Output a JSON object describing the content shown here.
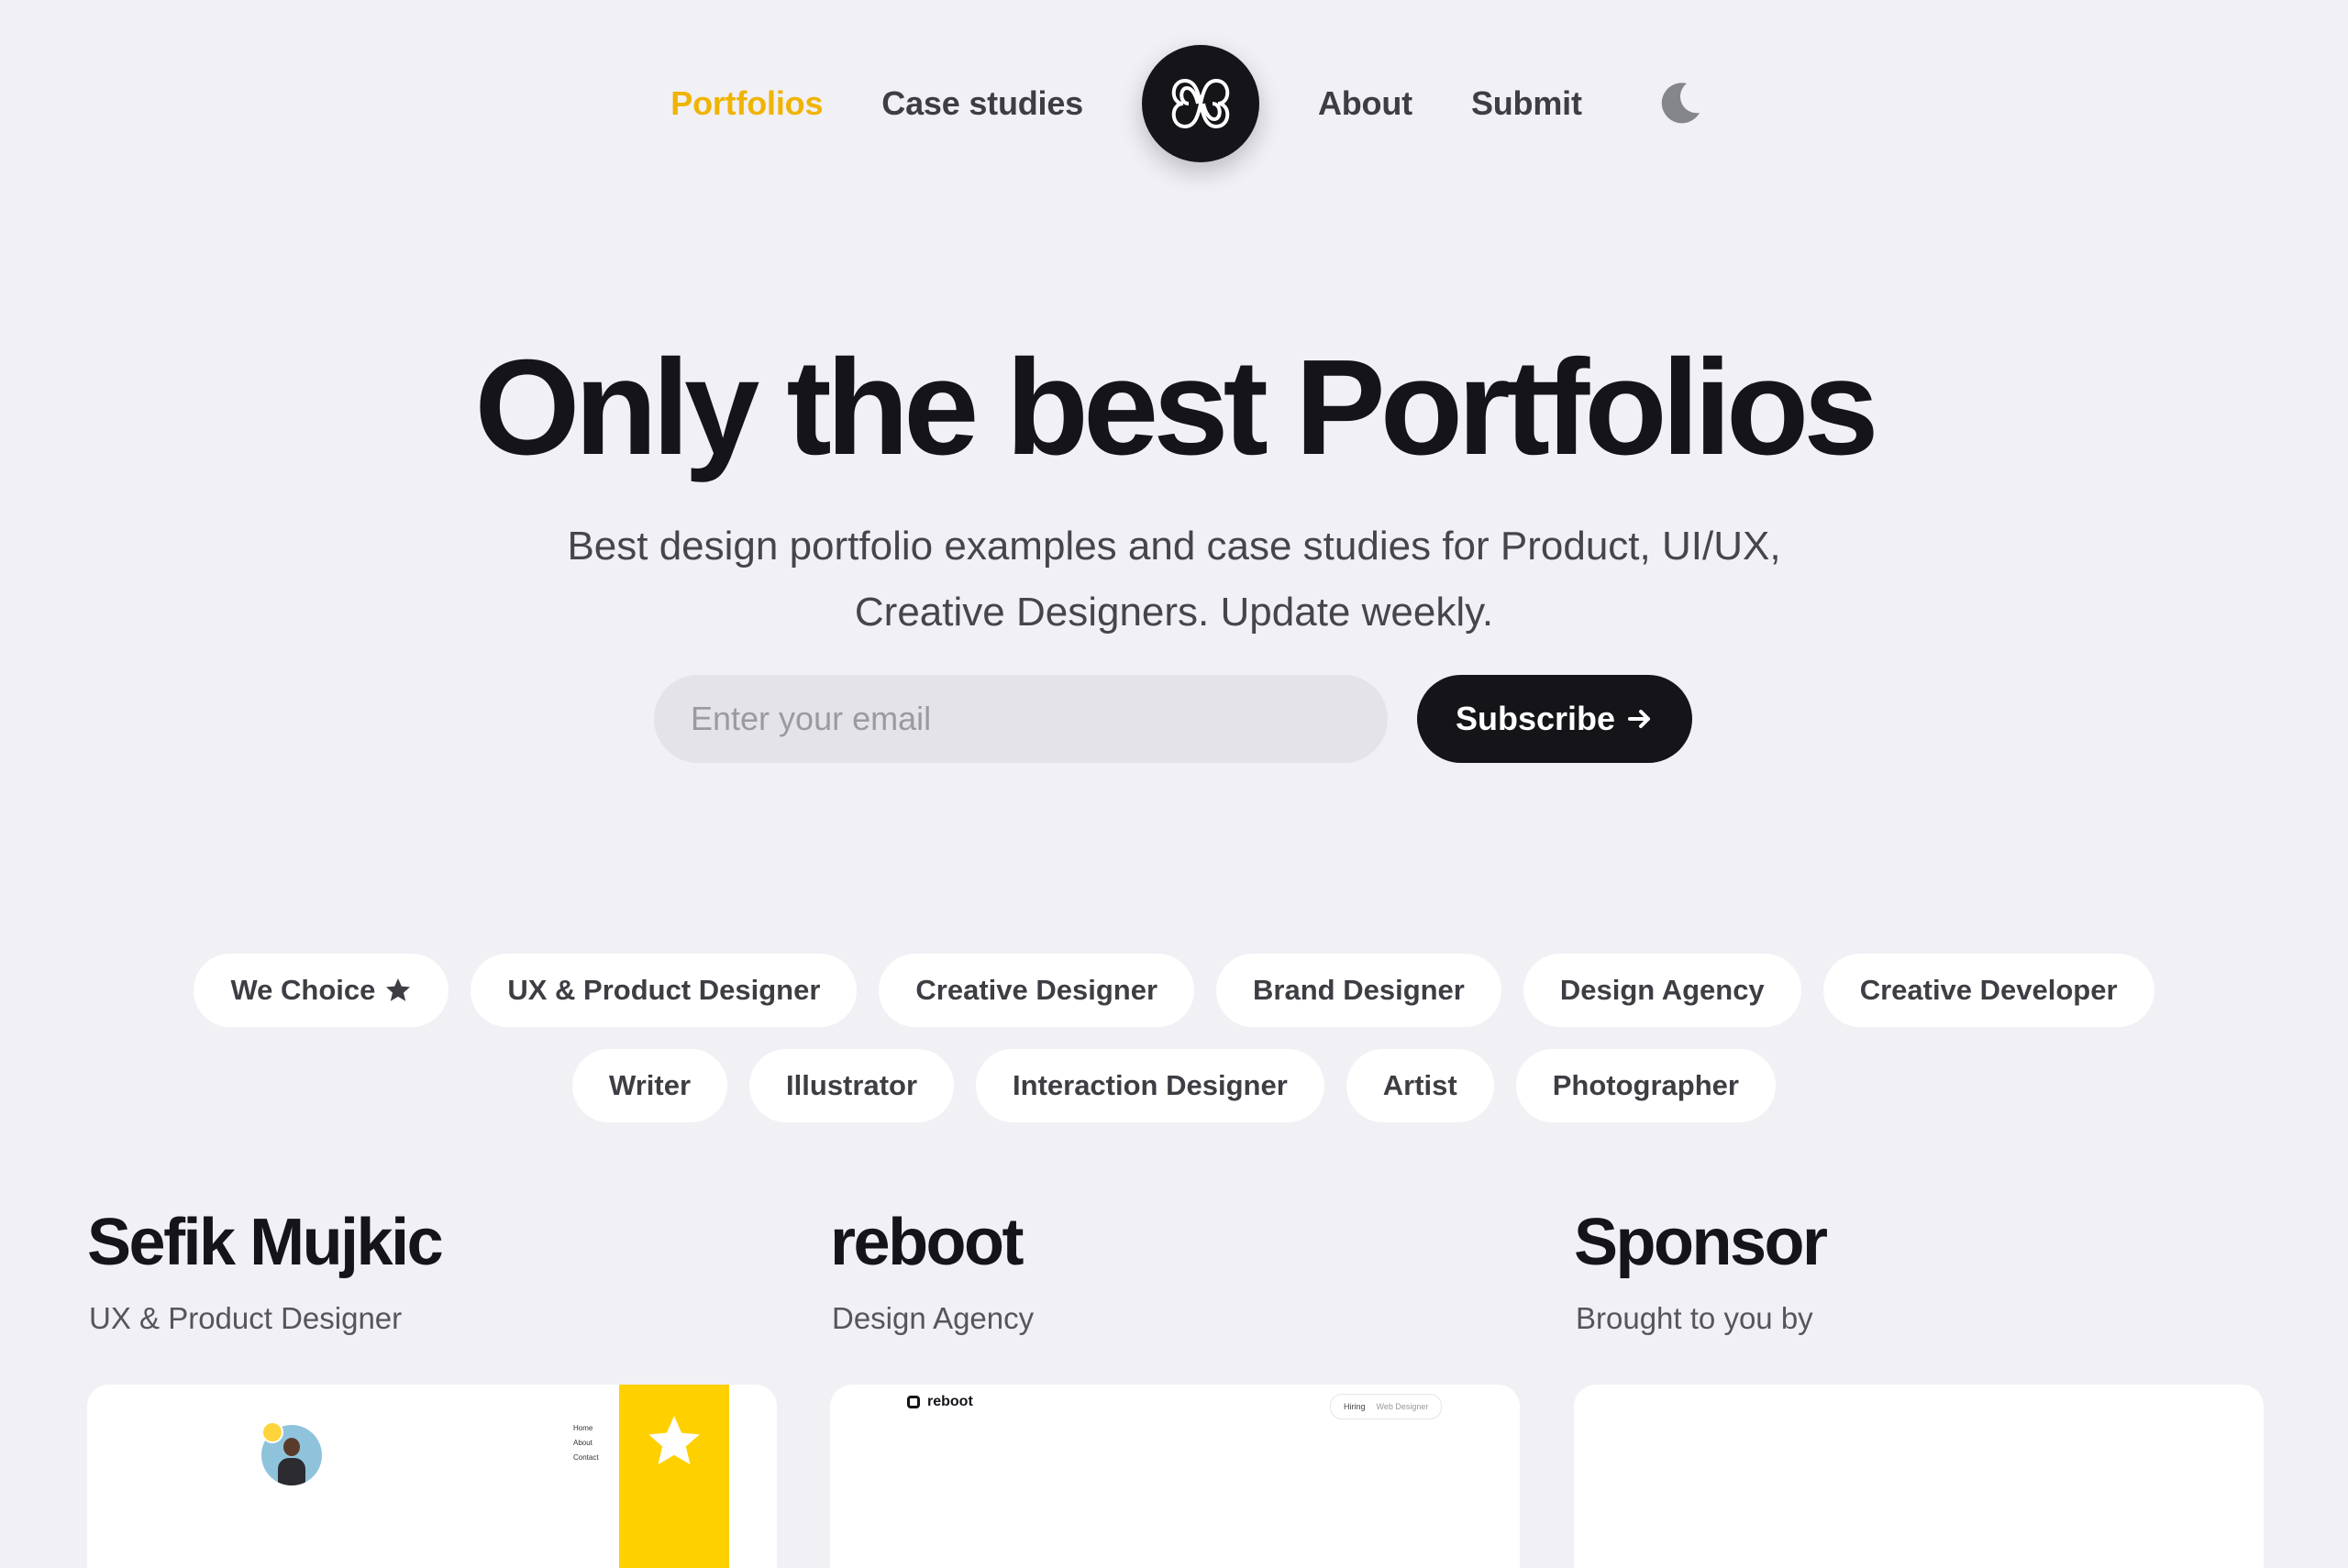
{
  "nav": {
    "links_left": [
      {
        "label": "Portfolios",
        "active": true
      },
      {
        "label": "Case studies",
        "active": false
      }
    ],
    "links_right": [
      {
        "label": "About",
        "active": false
      },
      {
        "label": "Submit",
        "active": false
      }
    ],
    "logo_icon": "bb-logo-icon",
    "theme_icon": "moon-icon"
  },
  "hero": {
    "title": "Only the best Portfolios",
    "subtitle_line1": "Best design portfolio examples and case studies for Product, UI/UX,",
    "subtitle_line2": "Creative Designers. Update weekly.",
    "email_placeholder": "Enter your email",
    "email_value": "",
    "subscribe_label": "Subscribe"
  },
  "filters": [
    {
      "label": "We Choice",
      "icon": "star-icon"
    },
    {
      "label": "UX & Product Designer"
    },
    {
      "label": "Creative Designer"
    },
    {
      "label": "Brand Designer"
    },
    {
      "label": "Design Agency"
    },
    {
      "label": "Creative Developer"
    },
    {
      "label": "Writer"
    },
    {
      "label": "Illustrator"
    },
    {
      "label": "Interaction Designer"
    },
    {
      "label": "Artist"
    },
    {
      "label": "Photographer"
    }
  ],
  "cards": [
    {
      "title": "Sefik Mujkic",
      "subtitle": "UX & Product Designer",
      "preview_menu": [
        "Home",
        "About",
        "Contact"
      ]
    },
    {
      "title": "reboot",
      "subtitle": "Design Agency",
      "preview_brand": "reboot",
      "preview_pill_a": "Hiring",
      "preview_pill_b": "Web Designer"
    },
    {
      "title": "Sponsor",
      "subtitle": "Brought to you by"
    }
  ],
  "colors": {
    "background": "#f1f0f5",
    "accent": "#f0b400",
    "dark": "#141419",
    "chip_bg": "#ffffff"
  }
}
